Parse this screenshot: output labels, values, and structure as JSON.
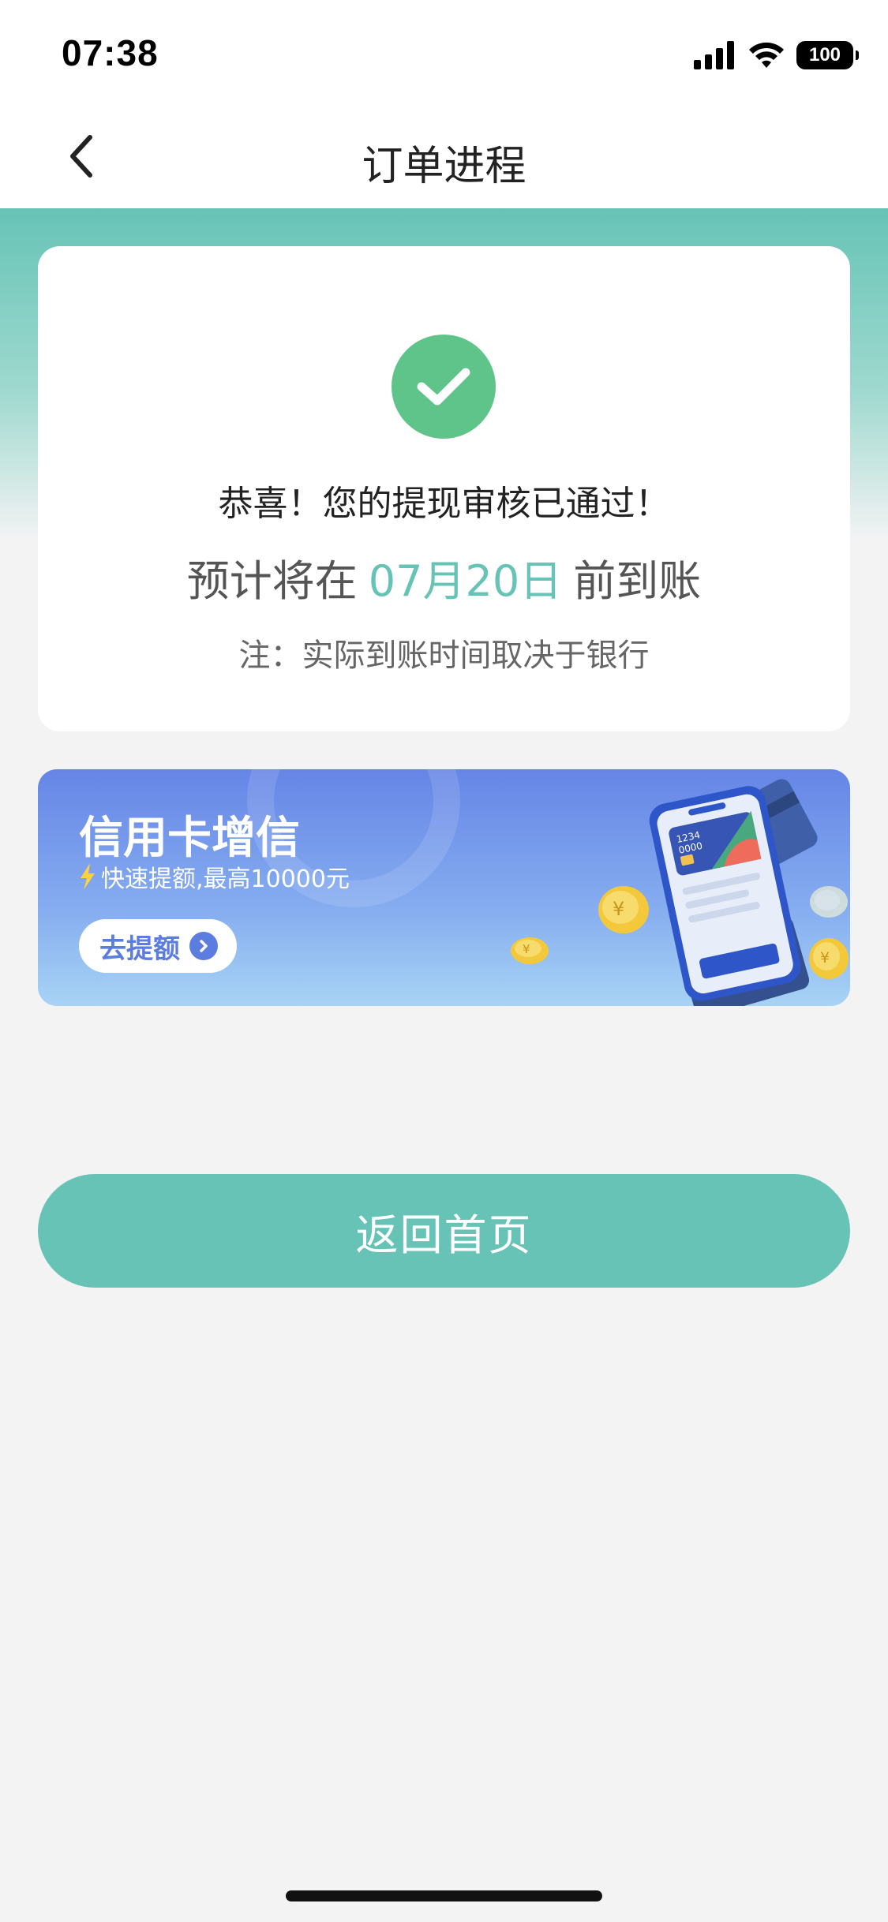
{
  "status_bar": {
    "time": "07:38",
    "battery": "100",
    "icons": [
      "signal-icon",
      "wifi-icon",
      "battery-icon"
    ]
  },
  "nav": {
    "back_icon": "chevron-left-icon",
    "title": "订单进程"
  },
  "result": {
    "icon": "check-circle-icon",
    "congrats": "恭喜！您的提现审核已通过！",
    "eta_prefix": "预计将在",
    "eta_date": "07月20日",
    "eta_suffix": "前到账",
    "note": "注：实际到账时间取决于银行"
  },
  "banner": {
    "title": "信用卡增信",
    "subtitle": "快速提额,最高10000元",
    "button_label": "去提额",
    "card_number_1": "1234",
    "card_number_2": "0000"
  },
  "home_button": {
    "label": "返回首页"
  },
  "colors": {
    "accent": "#66c3b6",
    "success": "#5fc489",
    "banner": "#6685e6",
    "background": "#f3f3f4"
  }
}
